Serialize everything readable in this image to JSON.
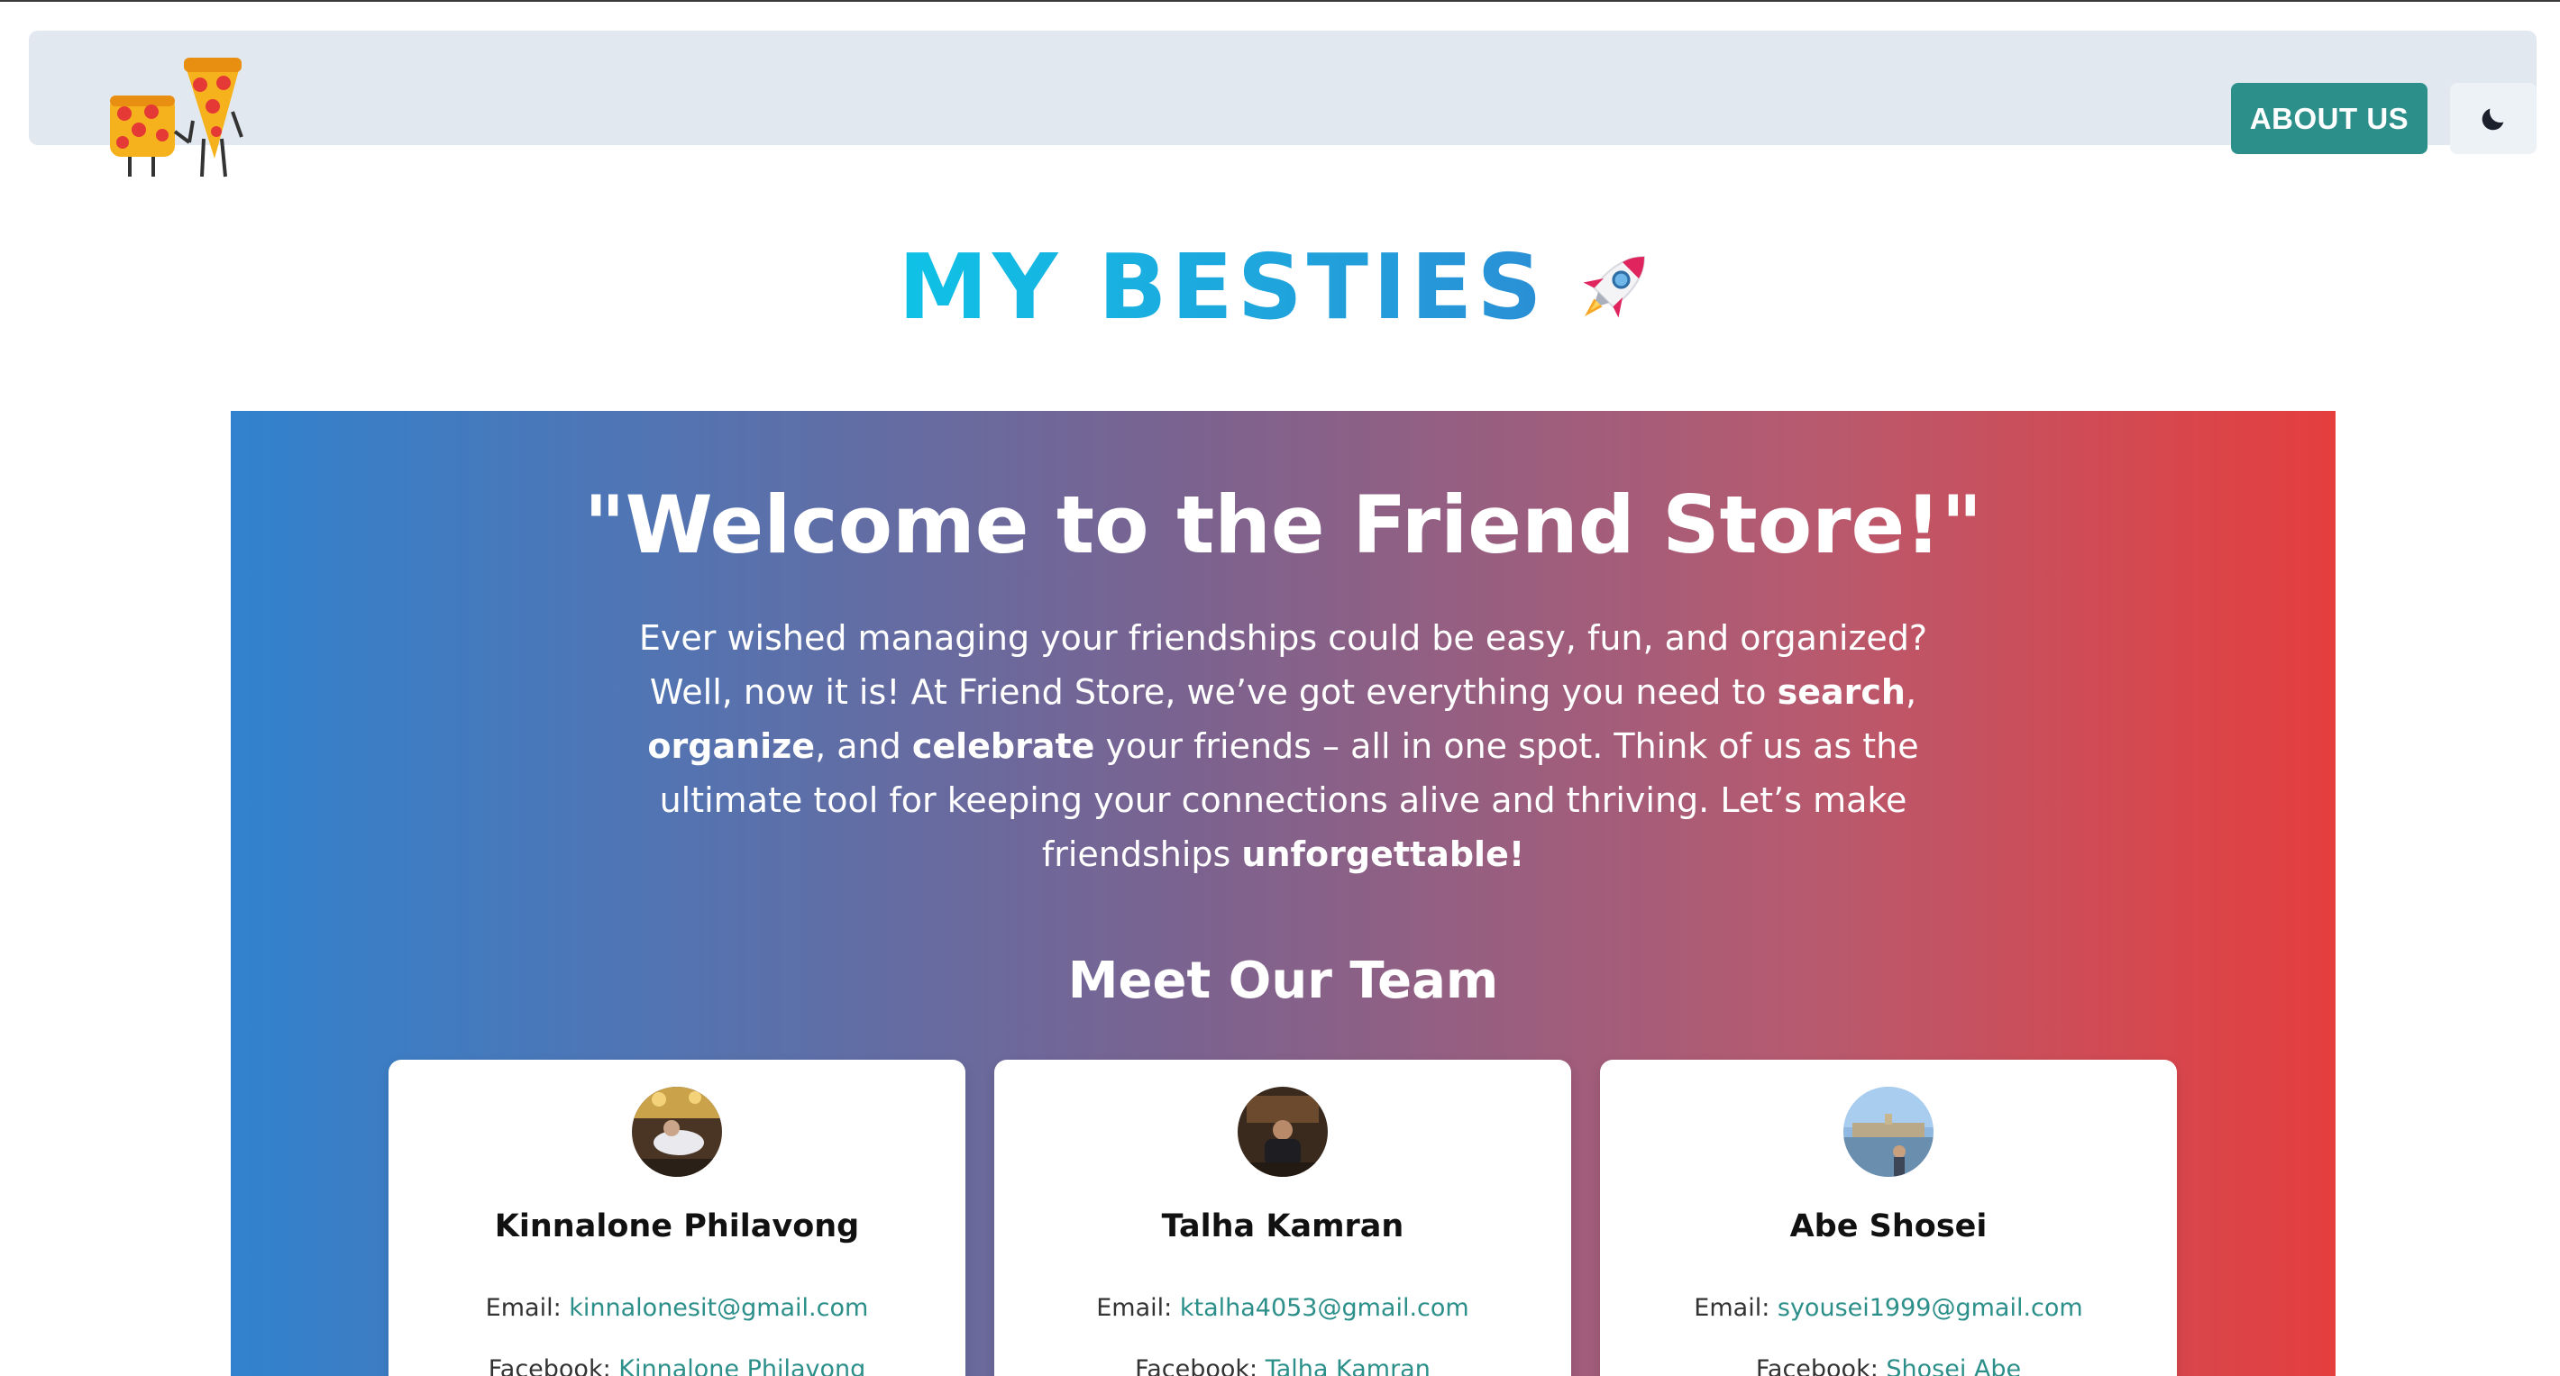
{
  "navbar": {
    "logo_alt": "pizza-friends-logo",
    "about_label": "ABOUT US",
    "theme_icon": "moon-icon"
  },
  "page": {
    "title": "MY BESTIES",
    "title_icon": "rocket-icon"
  },
  "hero": {
    "heading": "\"Welcome to the Friend Store!\"",
    "text_parts": [
      "Ever wished managing your friendships could be easy, fun, and organized? Well, now it is! At Friend Store, we’ve got everything you need to ",
      "search",
      ", ",
      "organize",
      ", and ",
      "celebrate",
      " your friends – all in one spot. Think of us as the ultimate tool for keeping your connections alive and thriving. Let’s make friendships ",
      "unforgettable!"
    ]
  },
  "team": {
    "heading": "Meet Our Team",
    "email_label": "Email: ",
    "facebook_label": "Facebook: ",
    "members": [
      {
        "name": "Kinnalone Philavong",
        "email": "kinnalonesit@gmail.com",
        "facebook": "Kinnalone Philavong"
      },
      {
        "name": "Talha Kamran",
        "email": "ktalha4053@gmail.com",
        "facebook": "Talha Kamran"
      },
      {
        "name": "Abe Shosei",
        "email": "syousei1999@gmail.com",
        "facebook": "Shosei Abe"
      }
    ]
  },
  "colors": {
    "accent": "#2c8f8a",
    "navbar_bg": "#e2e8f0",
    "gradient_start": "#3182ce",
    "gradient_end": "#e53e3e",
    "title_start": "#0fc2e6",
    "title_end": "#2b8fd6"
  }
}
